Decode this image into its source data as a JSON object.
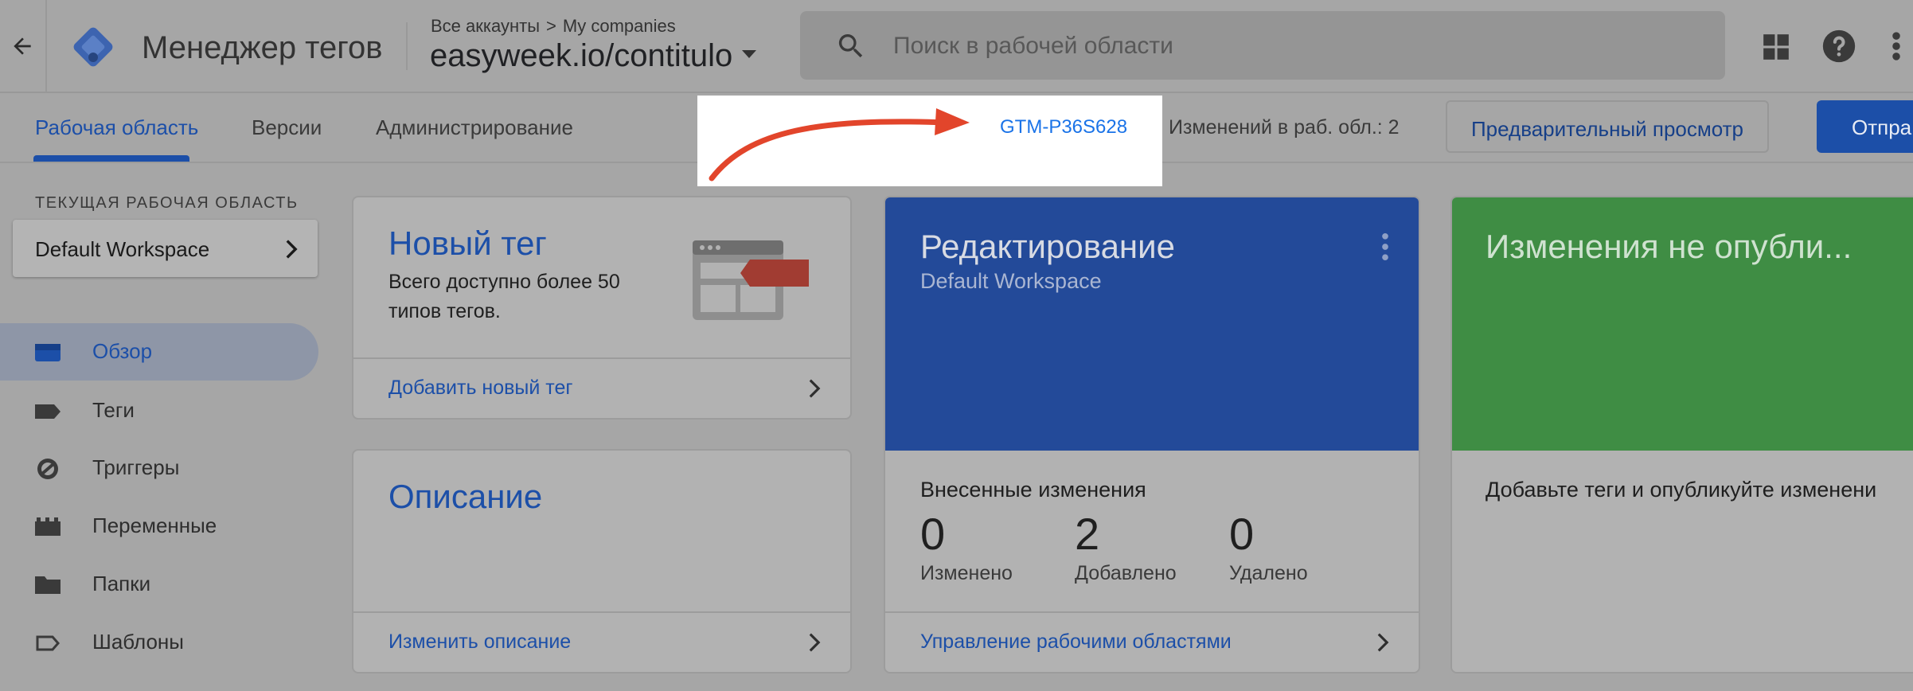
{
  "header": {
    "app_name": "Менеджер тегов",
    "breadcrumb": {
      "accounts": "Все аккаунты",
      "separator": ">",
      "account": "My companies"
    },
    "container": "easyweek.io/contitulo",
    "search": {
      "placeholder": "Поиск в рабочей области"
    }
  },
  "tabs": [
    {
      "label": "Рабочая область",
      "active": true
    },
    {
      "label": "Версии",
      "active": false
    },
    {
      "label": "Администрирование",
      "active": false
    }
  ],
  "toolbar": {
    "container_id": "GTM-P36S628",
    "changes_text": "Изменений в раб. обл.: 2",
    "preview_label": "Предварительный просмотр",
    "submit_label": "Отпра"
  },
  "sidebar": {
    "workspace_label": "ТЕКУЩАЯ РАБОЧАЯ ОБЛАСТЬ",
    "workspace_name": "Default Workspace",
    "items": [
      {
        "label": "Обзор",
        "icon": "overview-icon",
        "active": true
      },
      {
        "label": "Теги",
        "icon": "tag-icon",
        "active": false
      },
      {
        "label": "Триггеры",
        "icon": "trigger-icon",
        "active": false
      },
      {
        "label": "Переменные",
        "icon": "variables-icon",
        "active": false
      },
      {
        "label": "Папки",
        "icon": "folder-icon",
        "active": false
      },
      {
        "label": "Шаблоны",
        "icon": "template-icon",
        "active": false
      }
    ]
  },
  "cards": {
    "new_tag": {
      "title": "Новый тег",
      "text": "Всего доступно более 50 типов тегов.",
      "link": "Добавить новый тег"
    },
    "description": {
      "title": "Описание",
      "link": "Изменить описание"
    },
    "editing": {
      "title": "Редактирование",
      "subtitle": "Default Workspace",
      "heading": "Внесенные изменения",
      "stats": [
        {
          "value": "0",
          "label": "Изменено"
        },
        {
          "value": "2",
          "label": "Добавлено"
        },
        {
          "value": "0",
          "label": "Удалено"
        }
      ],
      "link": "Управление рабочими областями"
    },
    "publish": {
      "title": "Изменения не опубли...",
      "text": "Добавьте теги и опубликуйте изменени"
    }
  },
  "colors": {
    "accent": "#1c4fa8",
    "annotation_arrow": "#e2452b",
    "editing_card": "#234a99",
    "publish_card": "#3f8d44"
  }
}
